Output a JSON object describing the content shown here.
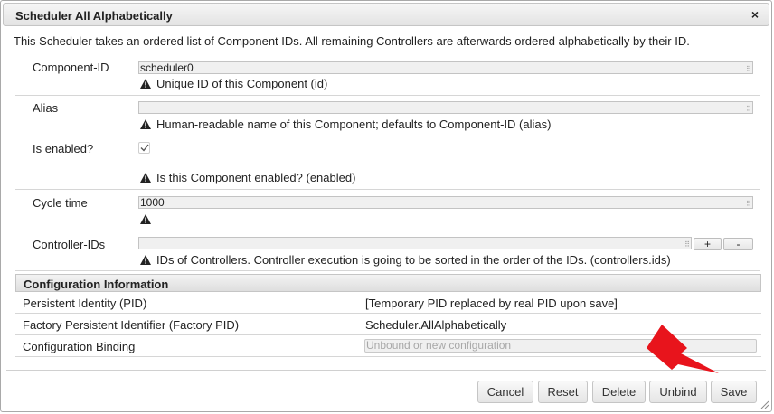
{
  "dialog": {
    "title": "Scheduler All Alphabetically",
    "close_icon": "×",
    "description": "This Scheduler takes an ordered list of Component IDs. All remaining Controllers are afterwards ordered alphabetically by their ID."
  },
  "properties": {
    "component_id": {
      "label": "Component-ID",
      "value": "scheduler0",
      "hint": "Unique ID of this Component (id)"
    },
    "alias": {
      "label": "Alias",
      "value": "",
      "hint": "Human-readable name of this Component; defaults to Component-ID (alias)"
    },
    "enabled": {
      "label": "Is enabled?",
      "checked": true,
      "hint": "Is this Component enabled? (enabled)"
    },
    "cycle_time": {
      "label": "Cycle time",
      "value": "1000",
      "hint": ""
    },
    "controller_ids": {
      "label": "Controller-IDs",
      "value": "",
      "add_label": "+",
      "remove_label": "-",
      "hint": "IDs of Controllers. Controller execution is going to be sorted in the order of the IDs. (controllers.ids)"
    }
  },
  "configuration": {
    "header": "Configuration Information",
    "pid_label": "Persistent Identity (PID)",
    "pid_value": "[Temporary PID replaced by real PID upon save]",
    "factory_pid_label": "Factory Persistent Identifier (Factory PID)",
    "factory_pid_value": "Scheduler.AllAlphabetically",
    "binding_label": "Configuration Binding",
    "binding_placeholder": "Unbound or new configuration"
  },
  "buttons": {
    "cancel": "Cancel",
    "reset": "Reset",
    "delete": "Delete",
    "unbind": "Unbind",
    "save": "Save"
  },
  "colors": {
    "annotation_arrow": "#e8141c"
  }
}
